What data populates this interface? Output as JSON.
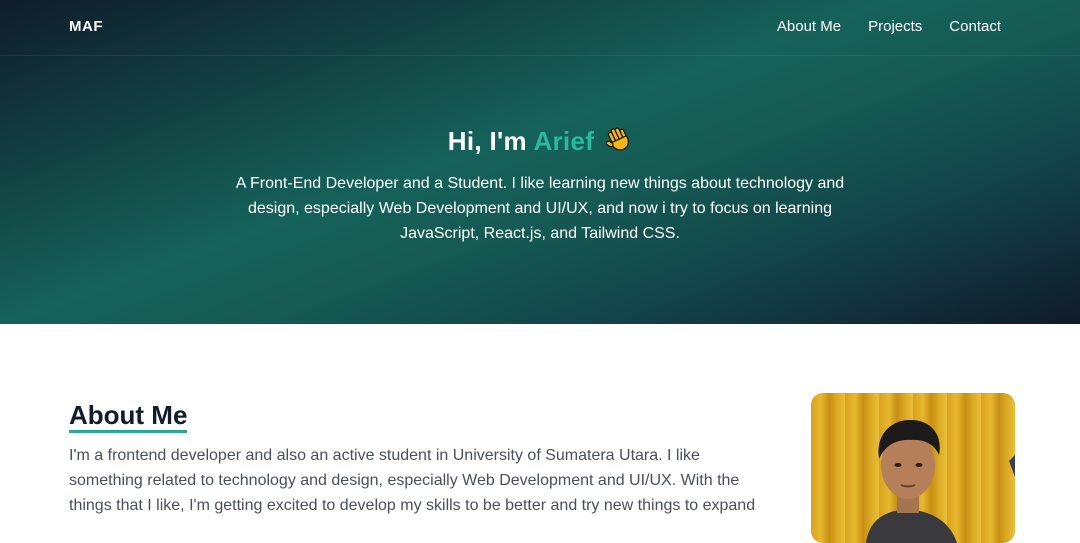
{
  "nav": {
    "logo": "MAF",
    "links": [
      "About Me",
      "Projects",
      "Contact"
    ]
  },
  "hero": {
    "greeting": "Hi, I'm ",
    "name": "Arief",
    "wave_icon": "waving-hand-icon",
    "description": "A Front-End Developer and a Student. I like learning new things about technology and design, especially Web Development and UI/UX, and now i try to focus on learning JavaScript, React.js, and Tailwind CSS."
  },
  "about": {
    "heading": "About Me",
    "text": "I'm a frontend developer and also an active student in University of Sumatera Utara. I like something related to technology and design, especially Web Development and UI/UX. With the things that I like, I'm getting excited to develop my skills to be better and try new things to expand"
  },
  "colors": {
    "accent": "#2bb8a0",
    "heading": "#141c2c",
    "body_text": "#4a4f58"
  }
}
